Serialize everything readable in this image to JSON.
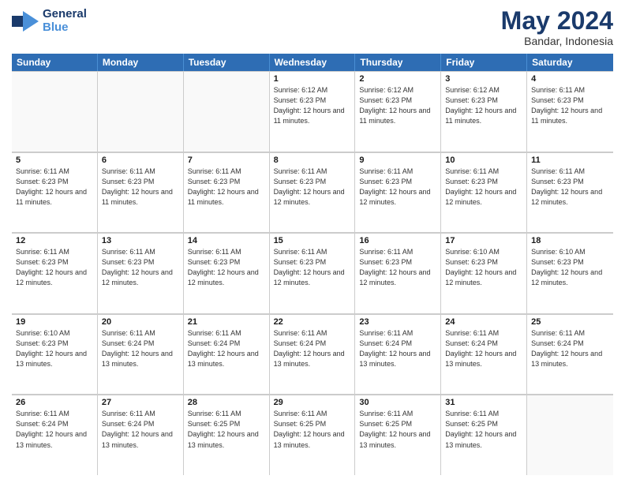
{
  "logo": {
    "part1": "General",
    "part2": "Blue"
  },
  "title": "May 2024",
  "subtitle": "Bandar, Indonesia",
  "weekdays": [
    "Sunday",
    "Monday",
    "Tuesday",
    "Wednesday",
    "Thursday",
    "Friday",
    "Saturday"
  ],
  "weeks": [
    [
      {
        "day": "",
        "empty": true
      },
      {
        "day": "",
        "empty": true
      },
      {
        "day": "",
        "empty": true
      },
      {
        "day": "1",
        "sunrise": "6:12 AM",
        "sunset": "6:23 PM",
        "daylight": "12 hours and 11 minutes."
      },
      {
        "day": "2",
        "sunrise": "6:12 AM",
        "sunset": "6:23 PM",
        "daylight": "12 hours and 11 minutes."
      },
      {
        "day": "3",
        "sunrise": "6:12 AM",
        "sunset": "6:23 PM",
        "daylight": "12 hours and 11 minutes."
      },
      {
        "day": "4",
        "sunrise": "6:11 AM",
        "sunset": "6:23 PM",
        "daylight": "12 hours and 11 minutes."
      }
    ],
    [
      {
        "day": "5",
        "sunrise": "6:11 AM",
        "sunset": "6:23 PM",
        "daylight": "12 hours and 11 minutes."
      },
      {
        "day": "6",
        "sunrise": "6:11 AM",
        "sunset": "6:23 PM",
        "daylight": "12 hours and 11 minutes."
      },
      {
        "day": "7",
        "sunrise": "6:11 AM",
        "sunset": "6:23 PM",
        "daylight": "12 hours and 11 minutes."
      },
      {
        "day": "8",
        "sunrise": "6:11 AM",
        "sunset": "6:23 PM",
        "daylight": "12 hours and 12 minutes."
      },
      {
        "day": "9",
        "sunrise": "6:11 AM",
        "sunset": "6:23 PM",
        "daylight": "12 hours and 12 minutes."
      },
      {
        "day": "10",
        "sunrise": "6:11 AM",
        "sunset": "6:23 PM",
        "daylight": "12 hours and 12 minutes."
      },
      {
        "day": "11",
        "sunrise": "6:11 AM",
        "sunset": "6:23 PM",
        "daylight": "12 hours and 12 minutes."
      }
    ],
    [
      {
        "day": "12",
        "sunrise": "6:11 AM",
        "sunset": "6:23 PM",
        "daylight": "12 hours and 12 minutes."
      },
      {
        "day": "13",
        "sunrise": "6:11 AM",
        "sunset": "6:23 PM",
        "daylight": "12 hours and 12 minutes."
      },
      {
        "day": "14",
        "sunrise": "6:11 AM",
        "sunset": "6:23 PM",
        "daylight": "12 hours and 12 minutes."
      },
      {
        "day": "15",
        "sunrise": "6:11 AM",
        "sunset": "6:23 PM",
        "daylight": "12 hours and 12 minutes."
      },
      {
        "day": "16",
        "sunrise": "6:11 AM",
        "sunset": "6:23 PM",
        "daylight": "12 hours and 12 minutes."
      },
      {
        "day": "17",
        "sunrise": "6:10 AM",
        "sunset": "6:23 PM",
        "daylight": "12 hours and 12 minutes."
      },
      {
        "day": "18",
        "sunrise": "6:10 AM",
        "sunset": "6:23 PM",
        "daylight": "12 hours and 12 minutes."
      }
    ],
    [
      {
        "day": "19",
        "sunrise": "6:10 AM",
        "sunset": "6:23 PM",
        "daylight": "12 hours and 13 minutes."
      },
      {
        "day": "20",
        "sunrise": "6:11 AM",
        "sunset": "6:24 PM",
        "daylight": "12 hours and 13 minutes."
      },
      {
        "day": "21",
        "sunrise": "6:11 AM",
        "sunset": "6:24 PM",
        "daylight": "12 hours and 13 minutes."
      },
      {
        "day": "22",
        "sunrise": "6:11 AM",
        "sunset": "6:24 PM",
        "daylight": "12 hours and 13 minutes."
      },
      {
        "day": "23",
        "sunrise": "6:11 AM",
        "sunset": "6:24 PM",
        "daylight": "12 hours and 13 minutes."
      },
      {
        "day": "24",
        "sunrise": "6:11 AM",
        "sunset": "6:24 PM",
        "daylight": "12 hours and 13 minutes."
      },
      {
        "day": "25",
        "sunrise": "6:11 AM",
        "sunset": "6:24 PM",
        "daylight": "12 hours and 13 minutes."
      }
    ],
    [
      {
        "day": "26",
        "sunrise": "6:11 AM",
        "sunset": "6:24 PM",
        "daylight": "12 hours and 13 minutes."
      },
      {
        "day": "27",
        "sunrise": "6:11 AM",
        "sunset": "6:24 PM",
        "daylight": "12 hours and 13 minutes."
      },
      {
        "day": "28",
        "sunrise": "6:11 AM",
        "sunset": "6:25 PM",
        "daylight": "12 hours and 13 minutes."
      },
      {
        "day": "29",
        "sunrise": "6:11 AM",
        "sunset": "6:25 PM",
        "daylight": "12 hours and 13 minutes."
      },
      {
        "day": "30",
        "sunrise": "6:11 AM",
        "sunset": "6:25 PM",
        "daylight": "12 hours and 13 minutes."
      },
      {
        "day": "31",
        "sunrise": "6:11 AM",
        "sunset": "6:25 PM",
        "daylight": "12 hours and 13 minutes."
      },
      {
        "day": "",
        "empty": true
      }
    ]
  ],
  "colors": {
    "header_bg": "#2e6db4",
    "header_text": "#ffffff",
    "title_color": "#1a3a6b"
  }
}
